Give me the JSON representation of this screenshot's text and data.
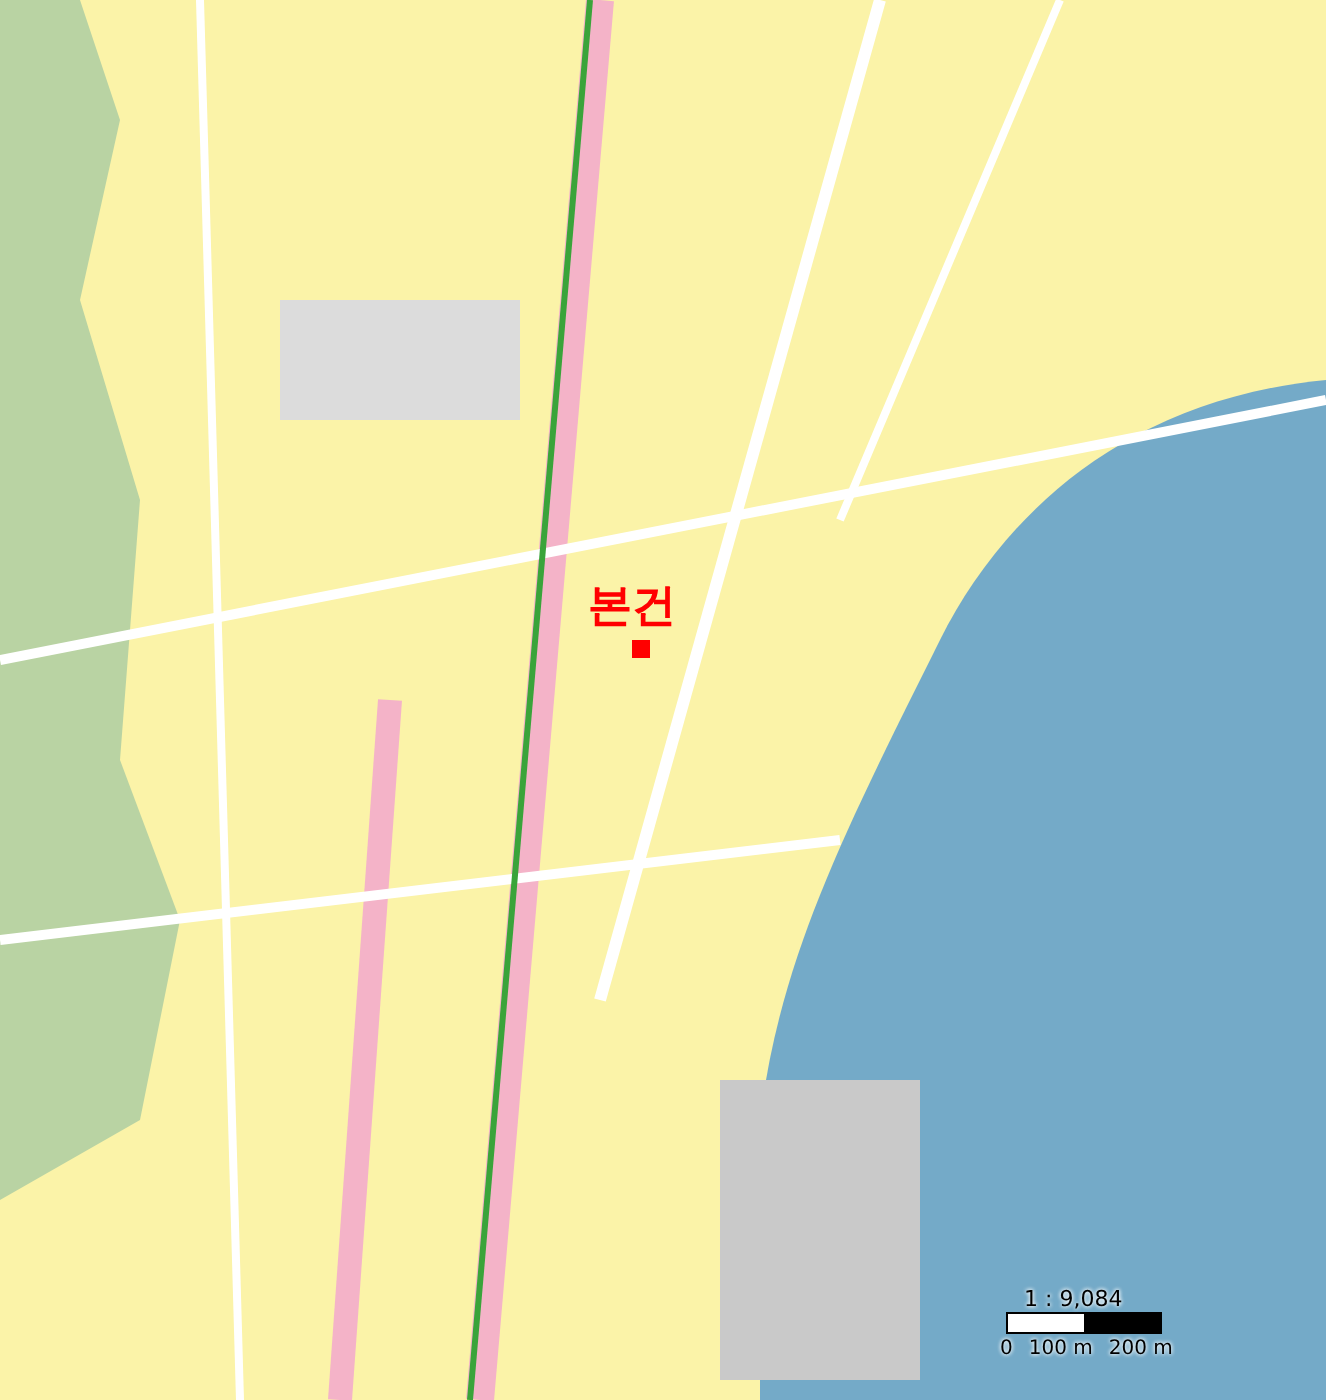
{
  "map": {
    "marker": {
      "label": "본건"
    },
    "scale": {
      "ratio": "1 : 9,084",
      "ticks": [
        "0",
        "100 m",
        "200 m"
      ]
    }
  }
}
